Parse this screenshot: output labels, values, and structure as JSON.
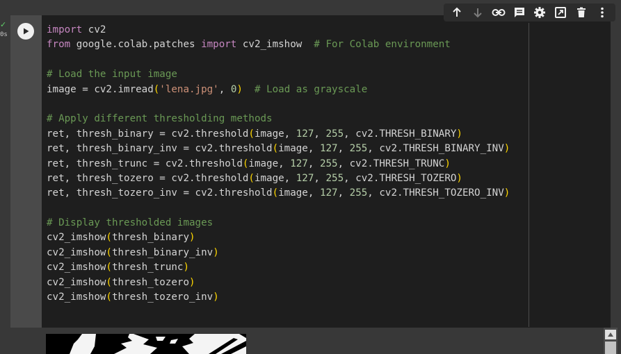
{
  "cell": {
    "exec_check": "✓",
    "exec_time": "0s",
    "code_lines": [
      [
        {
          "t": "import",
          "c": "kw"
        },
        {
          "t": " cv2",
          "c": ""
        }
      ],
      [
        {
          "t": "from",
          "c": "kw"
        },
        {
          "t": " google.colab.patches ",
          "c": ""
        },
        {
          "t": "import",
          "c": "kw"
        },
        {
          "t": " cv2_imshow  ",
          "c": ""
        },
        {
          "t": "# For Colab environment",
          "c": "cm"
        }
      ],
      [],
      [
        {
          "t": "# Load the input image",
          "c": "cm"
        }
      ],
      [
        {
          "t": "image = cv2.imread",
          "c": ""
        },
        {
          "t": "(",
          "c": "pa"
        },
        {
          "t": "'lena.jpg'",
          "c": "st"
        },
        {
          "t": ", ",
          "c": ""
        },
        {
          "t": "0",
          "c": "nm"
        },
        {
          "t": ")",
          "c": "pa"
        },
        {
          "t": "  ",
          "c": ""
        },
        {
          "t": "# Load as grayscale",
          "c": "cm"
        }
      ],
      [],
      [
        {
          "t": "# Apply different thresholding methods",
          "c": "cm"
        }
      ],
      [
        {
          "t": "ret, thresh_binary = cv2.threshold",
          "c": ""
        },
        {
          "t": "(",
          "c": "pa"
        },
        {
          "t": "image, ",
          "c": ""
        },
        {
          "t": "127",
          "c": "nm"
        },
        {
          "t": ", ",
          "c": ""
        },
        {
          "t": "255",
          "c": "nm"
        },
        {
          "t": ", cv2.THRESH_BINARY",
          "c": ""
        },
        {
          "t": ")",
          "c": "pa"
        }
      ],
      [
        {
          "t": "ret, thresh_binary_inv = cv2.threshold",
          "c": ""
        },
        {
          "t": "(",
          "c": "pa"
        },
        {
          "t": "image, ",
          "c": ""
        },
        {
          "t": "127",
          "c": "nm"
        },
        {
          "t": ", ",
          "c": ""
        },
        {
          "t": "255",
          "c": "nm"
        },
        {
          "t": ", cv2.THRESH_BINARY_INV",
          "c": ""
        },
        {
          "t": ")",
          "c": "pa"
        }
      ],
      [
        {
          "t": "ret, thresh_trunc = cv2.threshold",
          "c": ""
        },
        {
          "t": "(",
          "c": "pa"
        },
        {
          "t": "image, ",
          "c": ""
        },
        {
          "t": "127",
          "c": "nm"
        },
        {
          "t": ", ",
          "c": ""
        },
        {
          "t": "255",
          "c": "nm"
        },
        {
          "t": ", cv2.THRESH_TRUNC",
          "c": ""
        },
        {
          "t": ")",
          "c": "pa"
        }
      ],
      [
        {
          "t": "ret, thresh_tozero = cv2.threshold",
          "c": ""
        },
        {
          "t": "(",
          "c": "pa"
        },
        {
          "t": "image, ",
          "c": ""
        },
        {
          "t": "127",
          "c": "nm"
        },
        {
          "t": ", ",
          "c": ""
        },
        {
          "t": "255",
          "c": "nm"
        },
        {
          "t": ", cv2.THRESH_TOZERO",
          "c": ""
        },
        {
          "t": ")",
          "c": "pa"
        }
      ],
      [
        {
          "t": "ret, thresh_tozero_inv = cv2.threshold",
          "c": ""
        },
        {
          "t": "(",
          "c": "pa"
        },
        {
          "t": "image, ",
          "c": ""
        },
        {
          "t": "127",
          "c": "nm"
        },
        {
          "t": ", ",
          "c": ""
        },
        {
          "t": "255",
          "c": "nm"
        },
        {
          "t": ", cv2.THRESH_TOZERO_INV",
          "c": ""
        },
        {
          "t": ")",
          "c": "pa"
        }
      ],
      [],
      [
        {
          "t": "# Display thresholded images",
          "c": "cm"
        }
      ],
      [
        {
          "t": "cv2_imshow",
          "c": ""
        },
        {
          "t": "(",
          "c": "pa"
        },
        {
          "t": "thresh_binary",
          "c": ""
        },
        {
          "t": ")",
          "c": "pa"
        }
      ],
      [
        {
          "t": "cv2_imshow",
          "c": ""
        },
        {
          "t": "(",
          "c": "pa"
        },
        {
          "t": "thresh_binary_inv",
          "c": ""
        },
        {
          "t": ")",
          "c": "pa"
        }
      ],
      [
        {
          "t": "cv2_imshow",
          "c": ""
        },
        {
          "t": "(",
          "c": "pa"
        },
        {
          "t": "thresh_trunc",
          "c": ""
        },
        {
          "t": ")",
          "c": "pa"
        }
      ],
      [
        {
          "t": "cv2_imshow",
          "c": ""
        },
        {
          "t": "(",
          "c": "pa"
        },
        {
          "t": "thresh_tozero",
          "c": ""
        },
        {
          "t": ")",
          "c": "pa"
        }
      ],
      [
        {
          "t": "cv2_imshow",
          "c": ""
        },
        {
          "t": "(",
          "c": "pa"
        },
        {
          "t": "thresh_tozero_inv",
          "c": ""
        },
        {
          "t": ")",
          "c": "pa"
        }
      ]
    ]
  },
  "toolbar": {
    "buttons": [
      {
        "name": "move-up-button",
        "icon": "arrow-up-icon"
      },
      {
        "name": "move-down-button",
        "icon": "arrow-down-icon"
      },
      {
        "name": "copy-link-button",
        "icon": "link-icon"
      },
      {
        "name": "add-comment-button",
        "icon": "comment-icon"
      },
      {
        "name": "settings-button",
        "icon": "gear-icon"
      },
      {
        "name": "mirror-cell-button",
        "icon": "tab-icon"
      },
      {
        "name": "delete-button",
        "icon": "trash-icon"
      },
      {
        "name": "more-button",
        "icon": "more-vert-icon"
      }
    ]
  },
  "colors": {
    "keyword": "#c586c0",
    "comment": "#6a9955",
    "string": "#ce9178",
    "number": "#b5cea8",
    "paren": "#ffd700",
    "text": "#d4d4d4",
    "editor_bg": "#1e1e1e"
  }
}
